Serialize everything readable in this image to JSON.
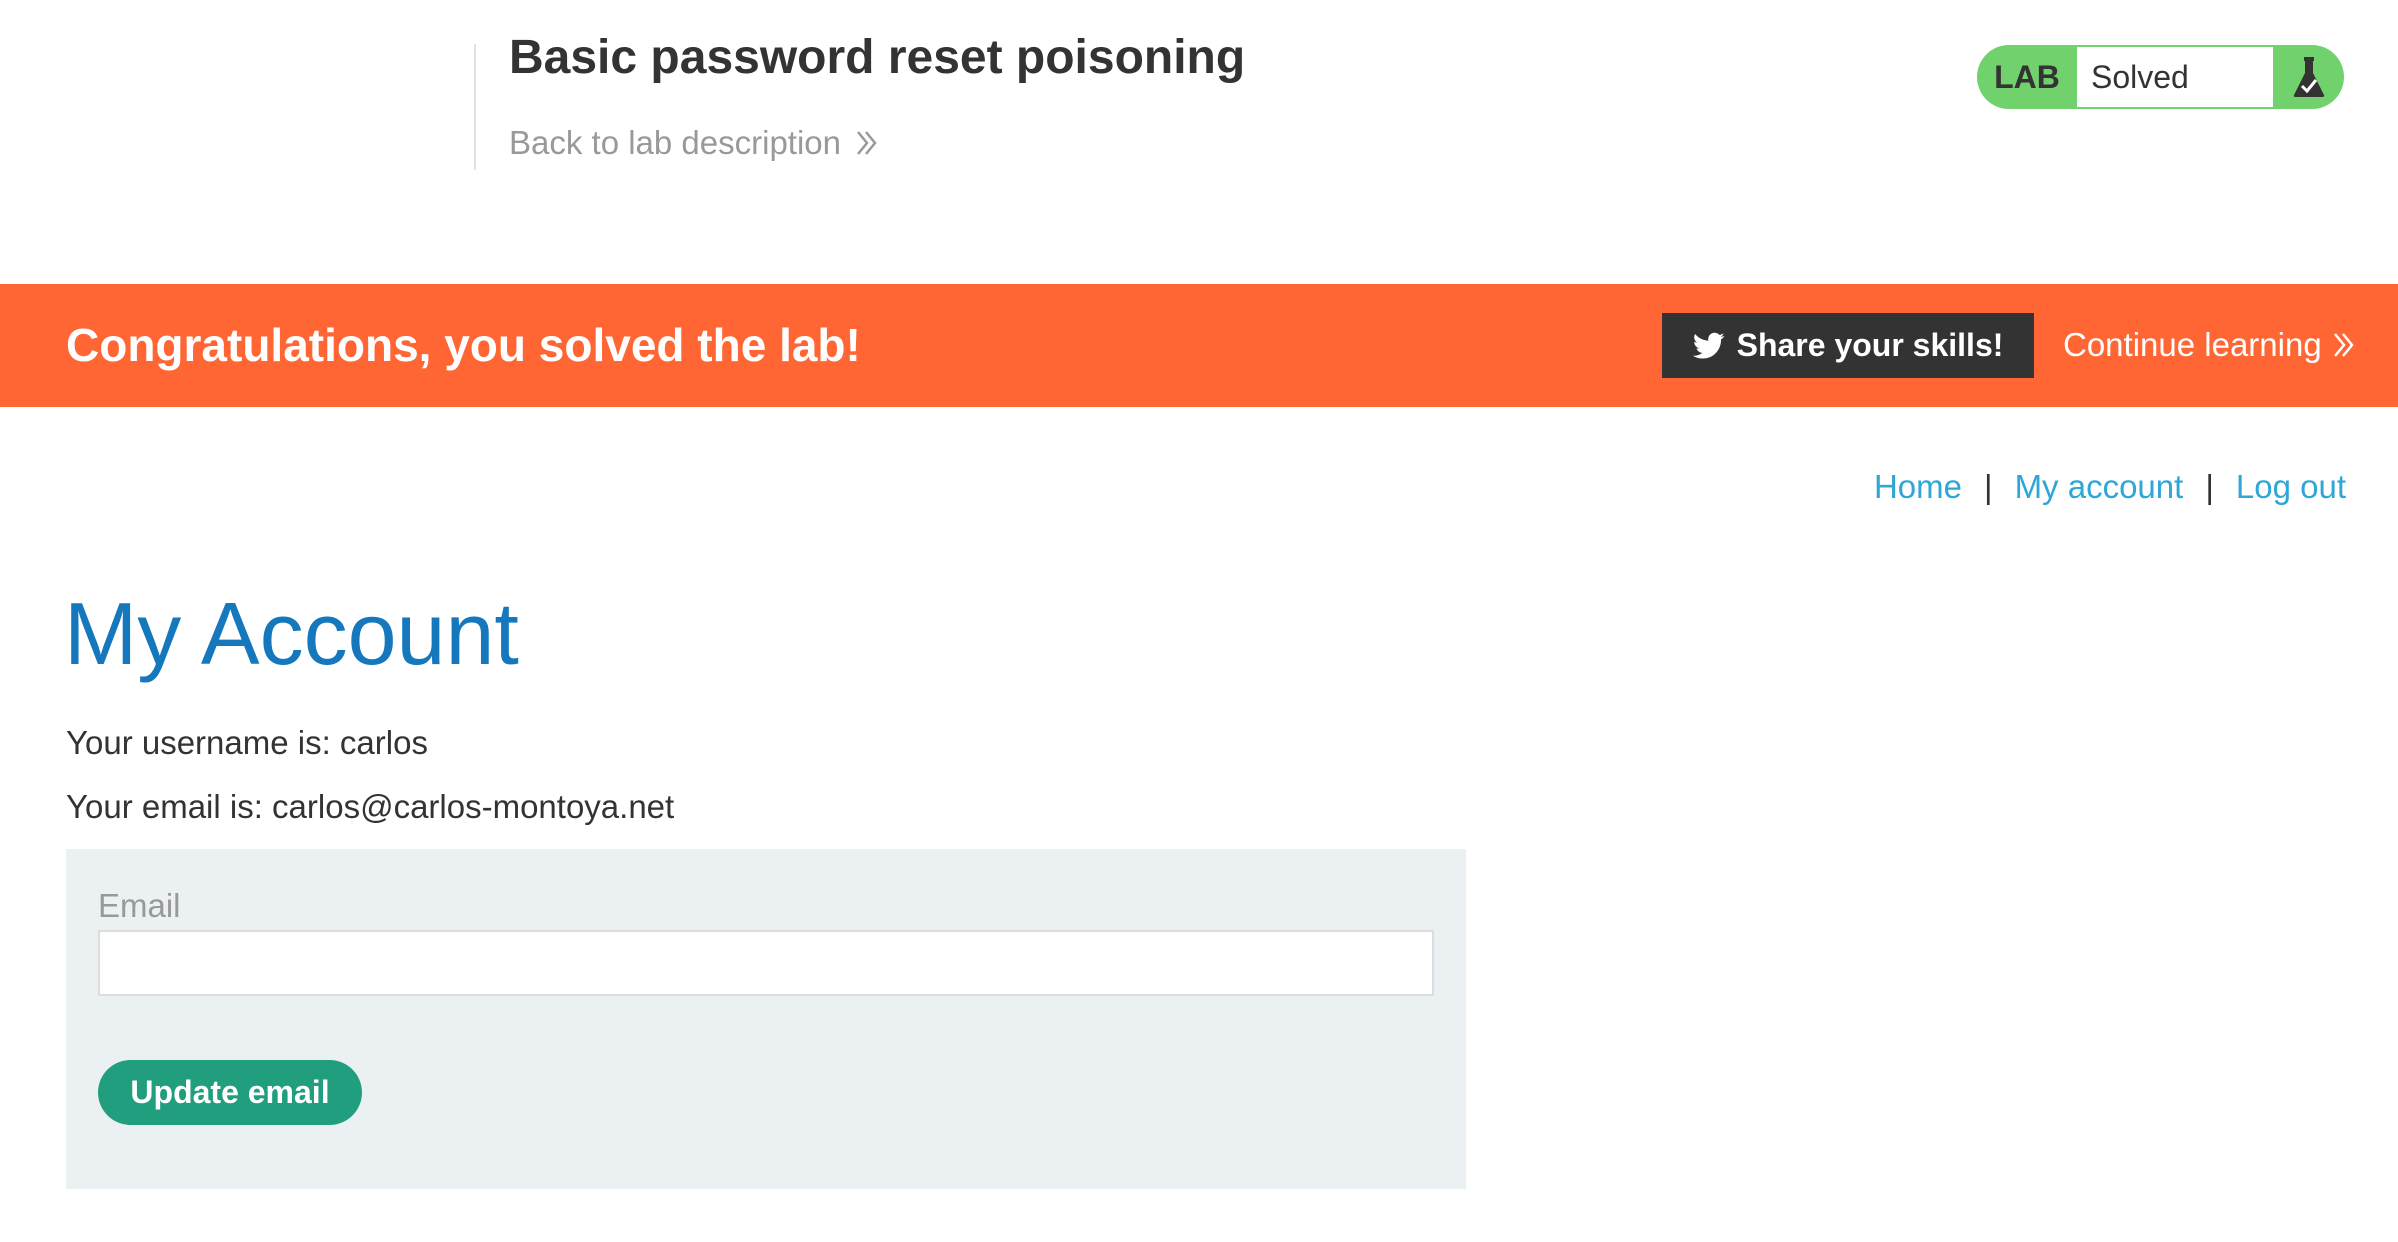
{
  "lab": {
    "title": "Basic password reset poisoning",
    "back_link": "Back to lab description",
    "badge_label": "LAB",
    "status": "Solved"
  },
  "banner": {
    "message": "Congratulations, you solved the lab!",
    "share_label": "Share your skills!",
    "continue_label": "Continue learning"
  },
  "nav": {
    "home": "Home",
    "separator": "|",
    "my_account": "My account",
    "log_out": "Log out"
  },
  "account": {
    "heading": "My Account",
    "username_line": "Your username is: carlos",
    "email_line": "Your email is: carlos@carlos-montoya.net"
  },
  "form": {
    "email_label": "Email",
    "email_value": "",
    "submit_label": "Update email"
  },
  "colors": {
    "banner": "#ff6633",
    "lab_badge": "#70d16d",
    "heading": "#1578bd",
    "link": "#2ea6d6",
    "submit_button": "#219e7d",
    "share_button": "#333333"
  },
  "icons": {
    "back": "double-chevron-right-icon",
    "status": "flask-check-icon",
    "share": "twitter-bird-icon",
    "continue": "double-chevron-right-icon"
  }
}
